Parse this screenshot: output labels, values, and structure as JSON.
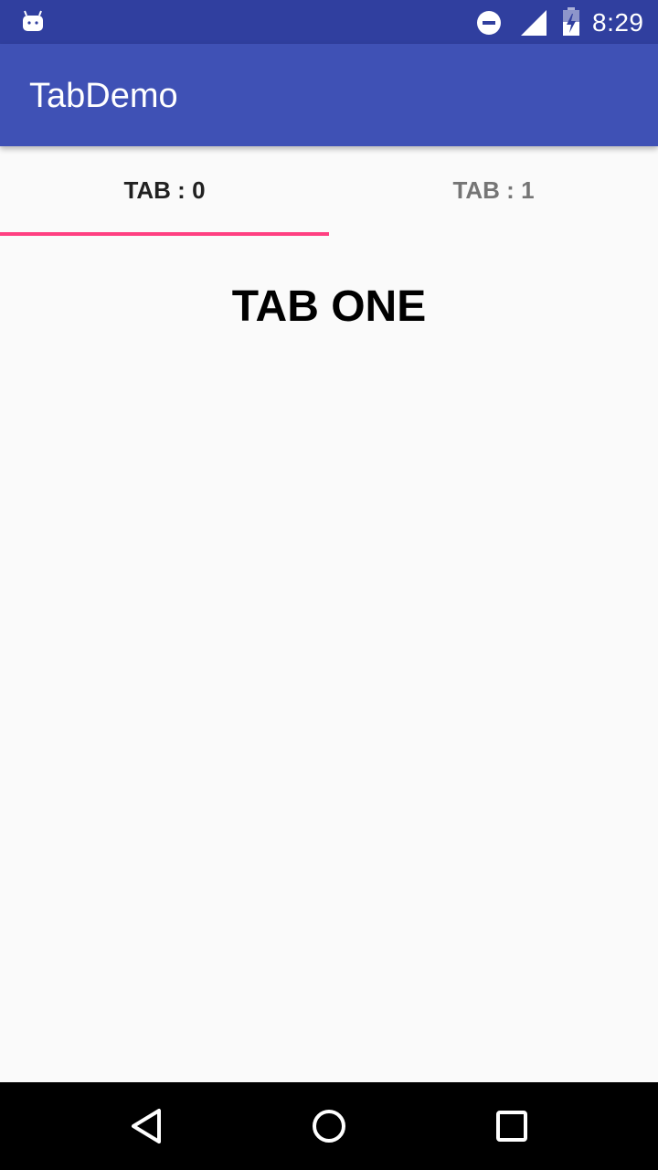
{
  "status_bar": {
    "time": "8:29",
    "icons": [
      "android-notification-icon",
      "do-not-disturb-icon",
      "cell-signal-icon",
      "battery-charging-icon"
    ]
  },
  "app_bar": {
    "title": "TabDemo",
    "color": "#3f51b5"
  },
  "tabs": [
    {
      "label": "TAB : 0",
      "selected": true
    },
    {
      "label": "TAB : 1",
      "selected": false
    }
  ],
  "tab_indicator_color": "#ff4081",
  "content": {
    "heading": "TAB ONE"
  },
  "nav_bar": {
    "buttons": [
      "back-icon",
      "home-icon",
      "recents-icon"
    ]
  }
}
